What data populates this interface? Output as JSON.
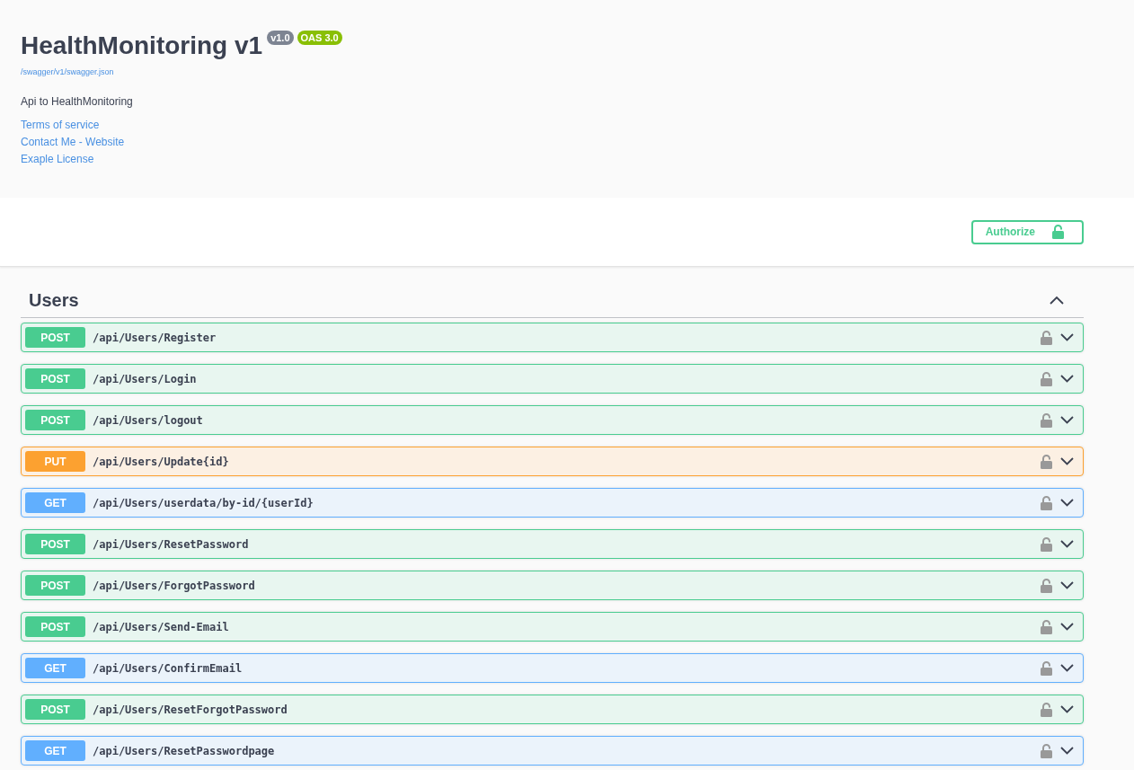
{
  "info": {
    "title": "HealthMonitoring v1",
    "badges": [
      {
        "label": "v1.0",
        "kind": "version"
      },
      {
        "label": "OAS 3.0",
        "kind": "oas"
      }
    ],
    "spec_url": "/swagger/v1/swagger.json",
    "description": "Api to HealthMonitoring",
    "links": [
      "Terms of service",
      "Contact Me - Website",
      "Exaple License"
    ]
  },
  "authorize_button": {
    "label": "Authorize"
  },
  "tag": {
    "name": "Users",
    "expanded": true,
    "operations": [
      {
        "method": "POST",
        "kind": "post",
        "path": "/api/Users/Register",
        "expanded": false
      },
      {
        "method": "POST",
        "kind": "post",
        "path": "/api/Users/Login",
        "expanded": false
      },
      {
        "method": "POST",
        "kind": "post",
        "path": "/api/Users/logout",
        "expanded": false
      },
      {
        "method": "PUT",
        "kind": "put",
        "path": "/api/Users/Update{id}",
        "expanded": false
      },
      {
        "method": "GET",
        "kind": "get",
        "path": "/api/Users/userdata/by-id/{userId}",
        "expanded": false
      },
      {
        "method": "POST",
        "kind": "post",
        "path": "/api/Users/ResetPassword",
        "expanded": false
      },
      {
        "method": "POST",
        "kind": "post",
        "path": "/api/Users/ForgotPassword",
        "expanded": false
      },
      {
        "method": "POST",
        "kind": "post",
        "path": "/api/Users/Send-Email",
        "expanded": false
      },
      {
        "method": "GET",
        "kind": "get",
        "path": "/api/Users/ConfirmEmail",
        "expanded": false
      },
      {
        "method": "POST",
        "kind": "post",
        "path": "/api/Users/ResetForgotPassword",
        "expanded": false
      },
      {
        "method": "GET",
        "kind": "get",
        "path": "/api/Users/ResetPasswordpage",
        "expanded": false
      }
    ]
  }
}
